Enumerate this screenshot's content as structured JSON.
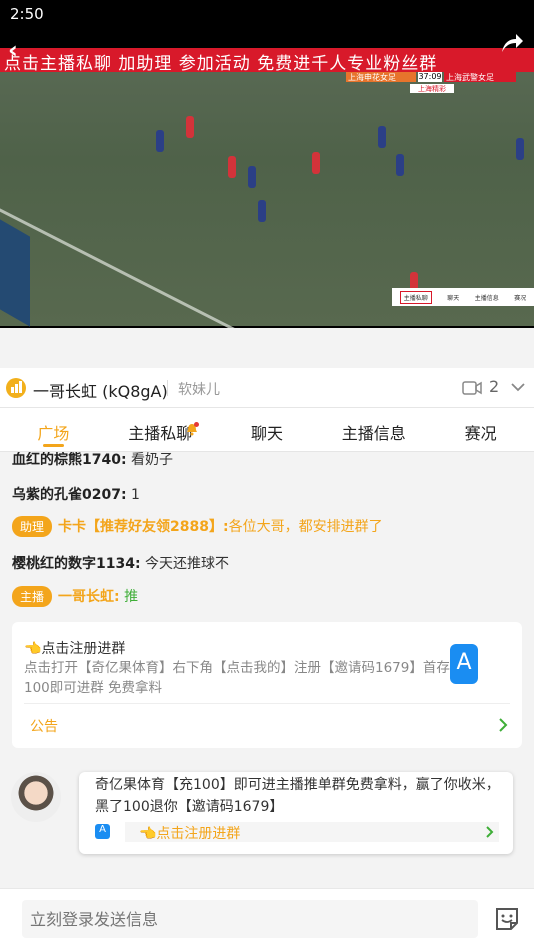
{
  "status": {
    "time": "2:50"
  },
  "video": {
    "banner": "点击主播私聊 加助理  参加活动 免费进千人专业粉丝群",
    "scoreboard": {
      "home_team": "上海申花女足",
      "home_score": "0",
      "time": "37:09",
      "away_score": "0",
      "away_team": "上海武警女足",
      "sub": "上海精彩"
    },
    "mini_tabs": [
      "主播私聊",
      "聊天",
      "主播信息",
      "赛况"
    ]
  },
  "anchor": {
    "name": "一哥长虹 (kQ8gA)",
    "tag": "软妹儿",
    "viewers": "2"
  },
  "tabs": [
    "广场",
    "主播私聊",
    "聊天",
    "主播信息",
    "赛况"
  ],
  "chat": {
    "messages": [
      {
        "user": "血红的棕熊1740:",
        "text": "看奶子"
      },
      {
        "user": "乌紫的孔雀0207:",
        "text": "1"
      },
      {
        "role": "助理",
        "user": "卡卡【推荐好友领2888】:",
        "text": "各位大哥，都安排进群了"
      },
      {
        "user": "樱桃红的数字1134:",
        "text": "今天还推球不"
      },
      {
        "role": "主播",
        "user": "一哥长虹:",
        "text": "推"
      }
    ],
    "card": {
      "title": "👈点击注册进群",
      "body": "点击打开【奇亿果体育】右下角【点击我的】注册【邀请码1679】首存100即可进群 免费拿料",
      "notice": "公告"
    },
    "bubble": {
      "text": "奇亿果体育【充100】即可进主播推单群免费拿料，赢了你收米， 黑了100退你【邀请码1679】",
      "link": "👈点击注册进群"
    }
  },
  "footer": {
    "placeholder": "立刻登录发送信息"
  }
}
